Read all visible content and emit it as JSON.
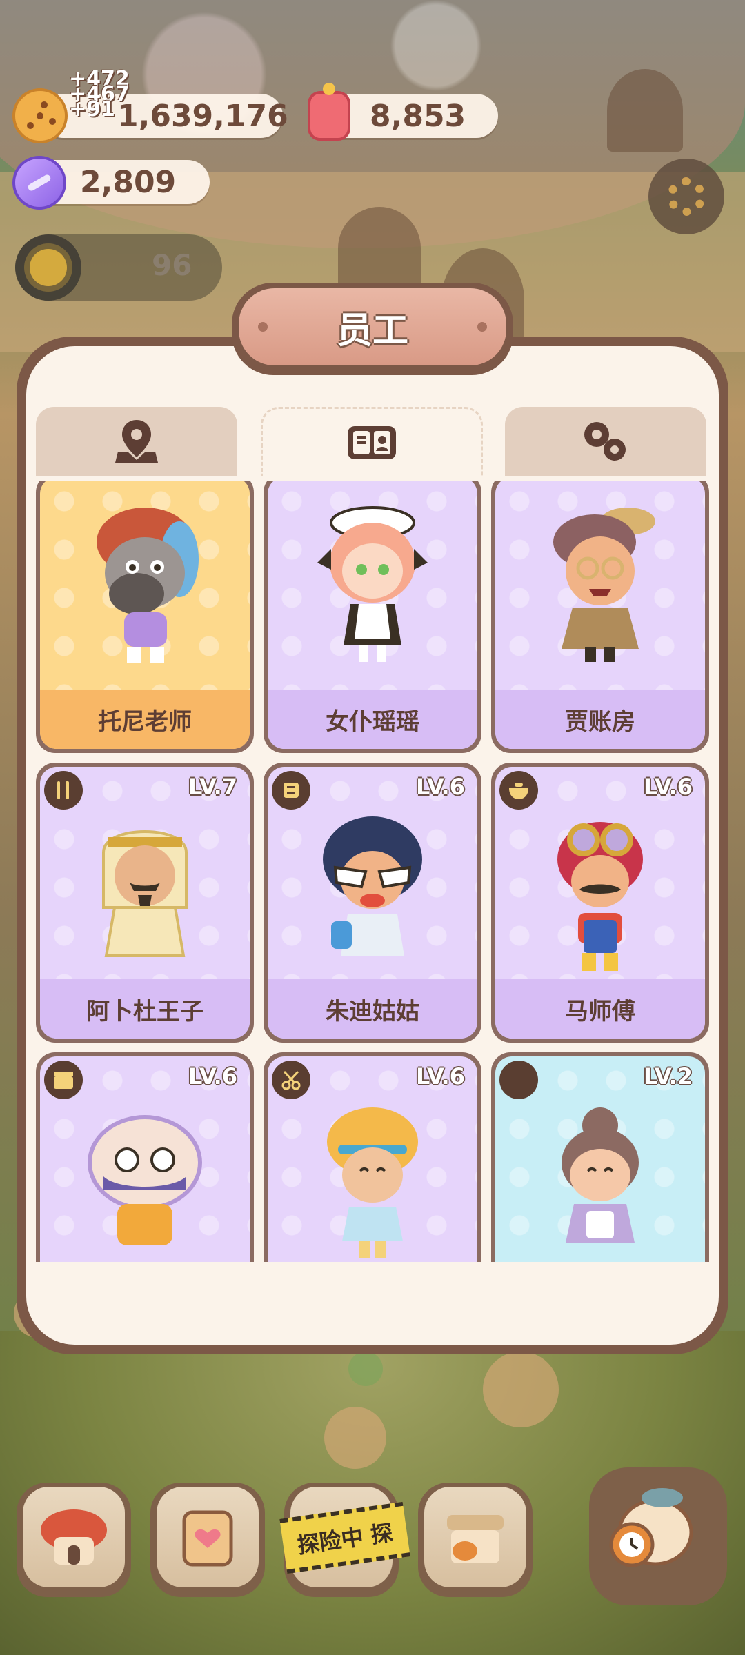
{
  "hud": {
    "cookies": "1,639,176",
    "jelly": "8,853",
    "candy": "2,809",
    "level": "96",
    "float_gains": [
      "+472",
      "+467",
      "+91"
    ]
  },
  "panel": {
    "title": "员工",
    "tabs": [
      {
        "icon": "map-pin-icon",
        "active": false
      },
      {
        "icon": "book-icon",
        "active": true
      },
      {
        "icon": "gears-icon",
        "active": false
      }
    ]
  },
  "staff": [
    {
      "name": "托尼老师",
      "level": "",
      "theme": "orange",
      "badge": ""
    },
    {
      "name": "女仆瑶瑶",
      "level": "",
      "theme": "purple",
      "badge": ""
    },
    {
      "name": "贾账房",
      "level": "",
      "theme": "purple",
      "badge": ""
    },
    {
      "name": "阿卜杜王子",
      "level": "LV.7",
      "theme": "purple",
      "badge": "utensils-icon"
    },
    {
      "name": "朱迪姑姑",
      "level": "LV.6",
      "theme": "purple",
      "badge": "menu-icon"
    },
    {
      "name": "马师傅",
      "level": "LV.6",
      "theme": "purple",
      "badge": "pot-icon"
    },
    {
      "name": "",
      "level": "LV.6",
      "theme": "purple",
      "badge": "clapper-icon"
    },
    {
      "name": "",
      "level": "LV.6",
      "theme": "purple",
      "badge": "scissors-icon"
    },
    {
      "name": "",
      "level": "LV.2",
      "theme": "blue",
      "badge": "empty-badge-icon"
    }
  ],
  "bottom_nav": {
    "explore_label": "探险中 探"
  },
  "colors": {
    "panel_border": "#7c5847",
    "panel_fill": "#fbf3ea",
    "card_purple": "#e6d4fb",
    "card_orange": "#fdd98c",
    "card_blue": "#c8eef6"
  }
}
